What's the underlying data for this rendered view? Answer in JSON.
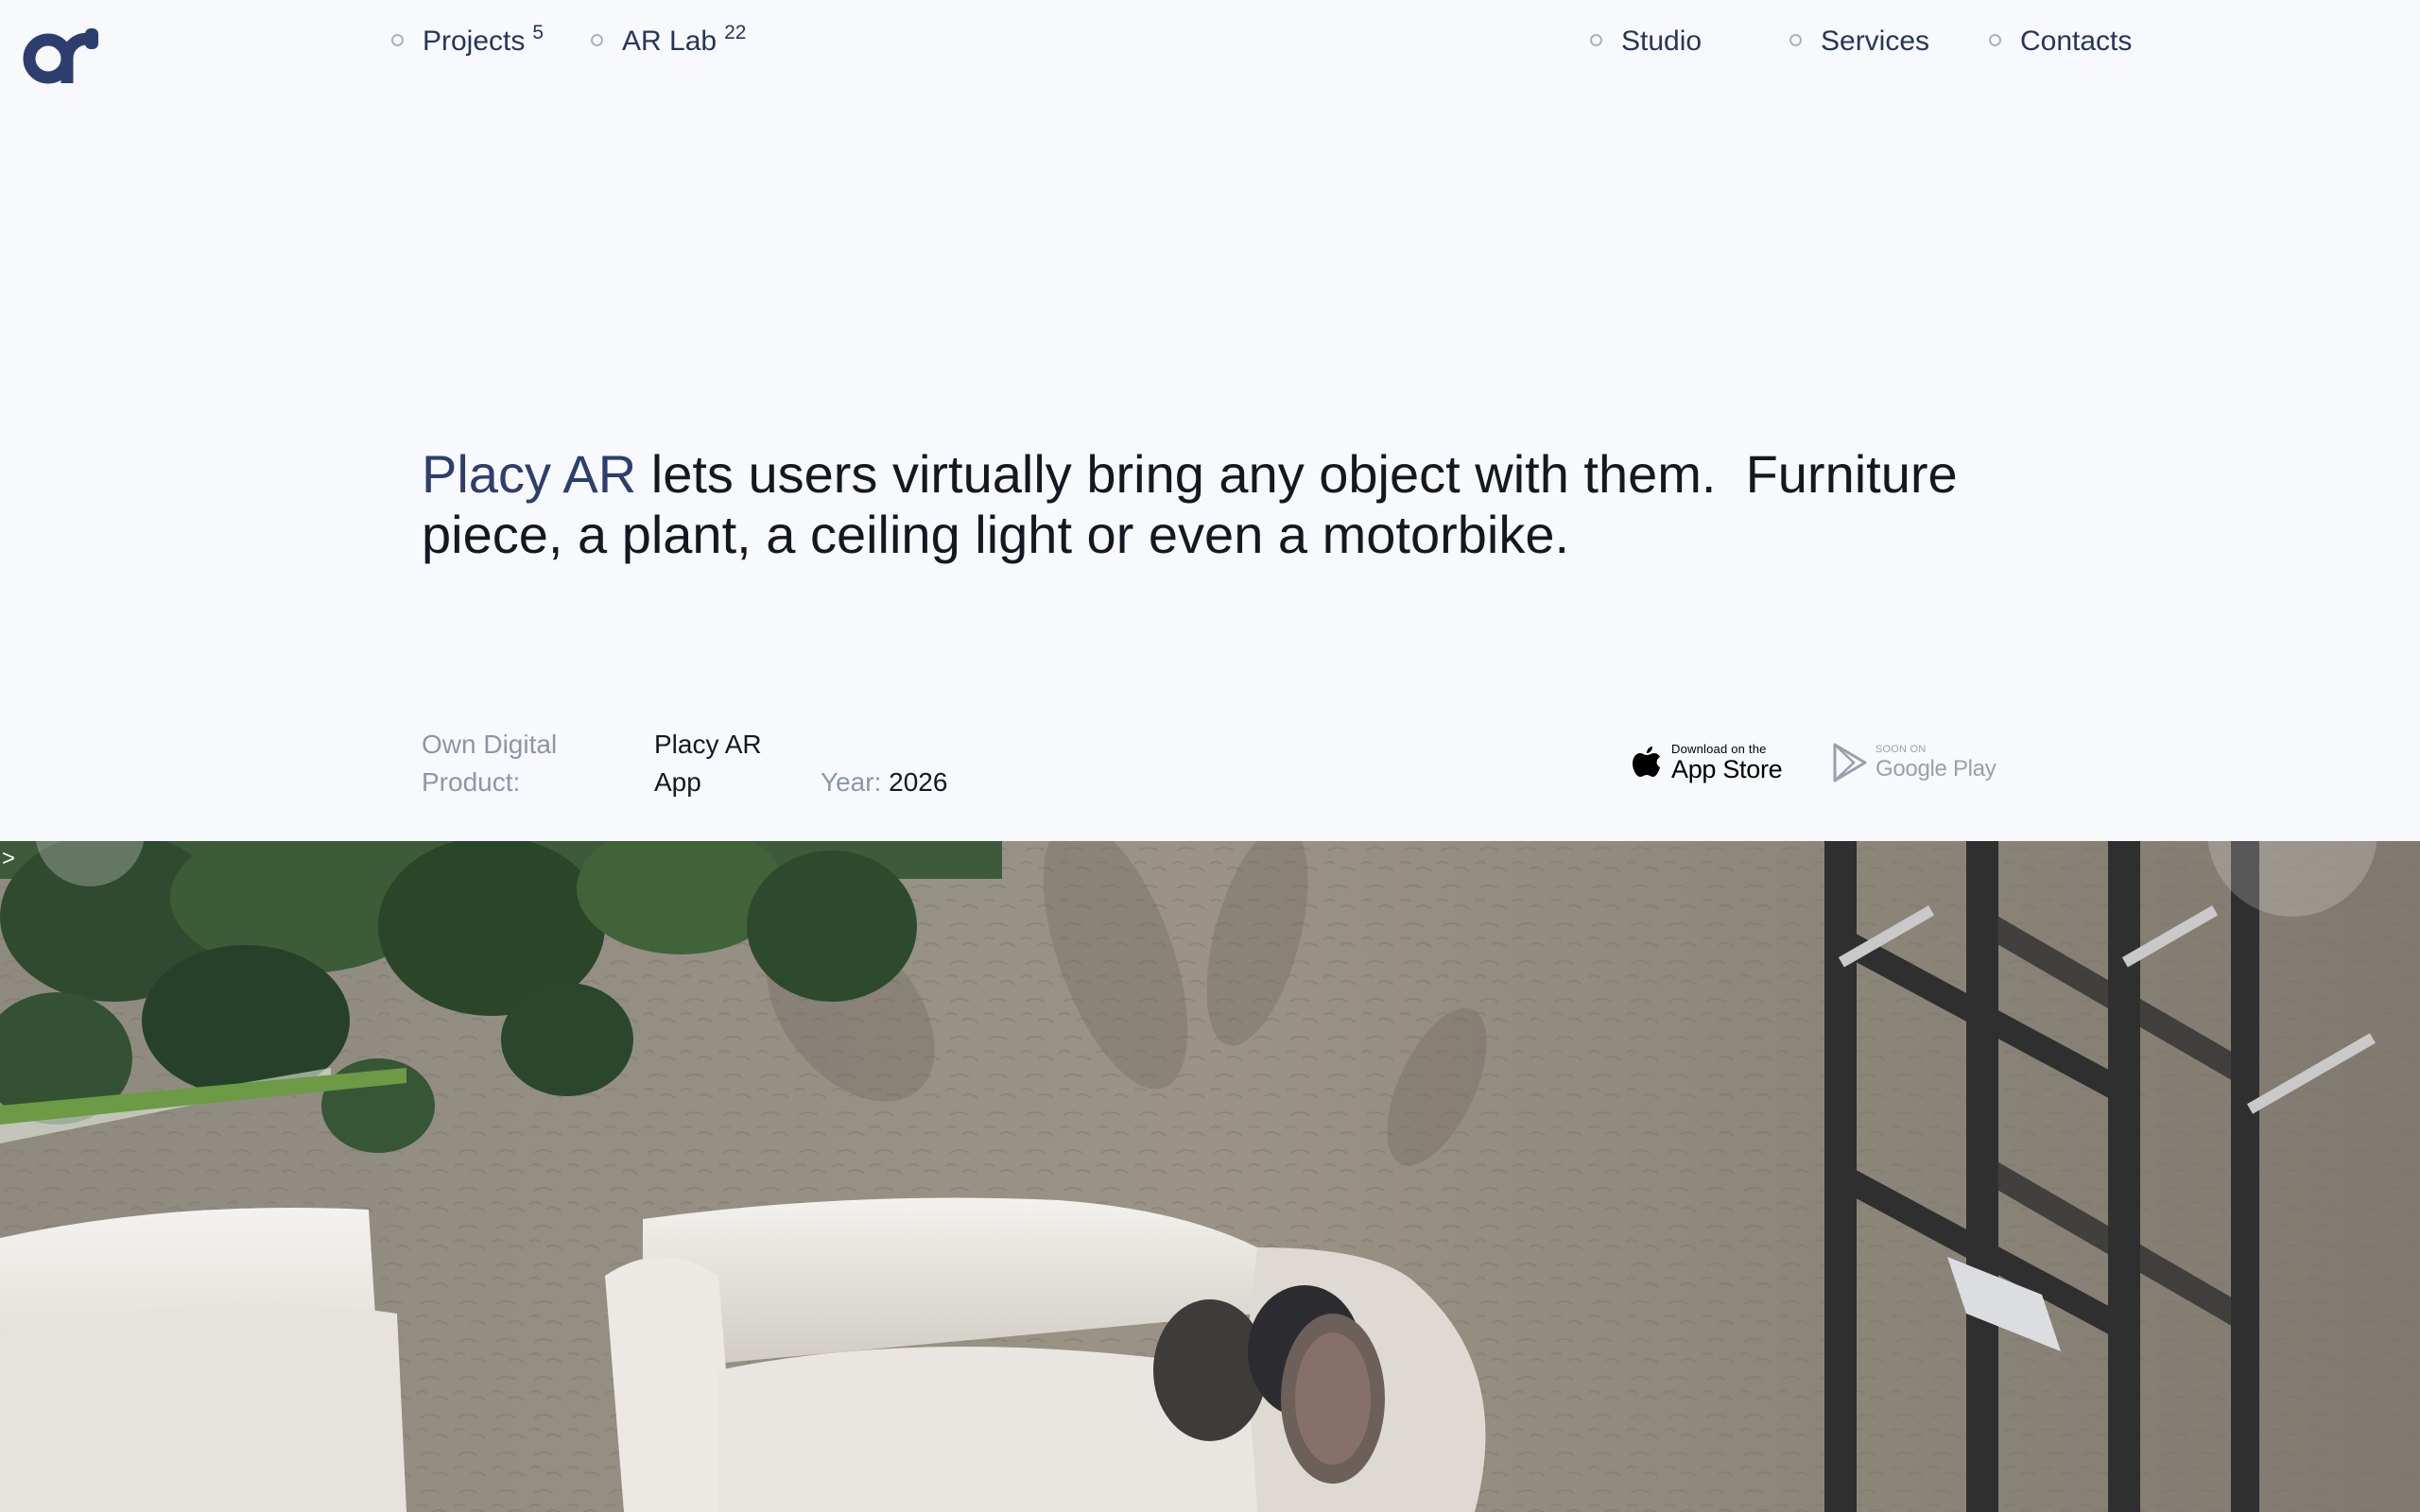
{
  "nav": {
    "left": [
      {
        "label": "Projects",
        "count": "5"
      },
      {
        "label": "AR Lab",
        "count": "22"
      }
    ],
    "right": [
      {
        "label": "Studio"
      },
      {
        "label": "Services"
      },
      {
        "label": "Contacts"
      }
    ]
  },
  "headline": {
    "brand": "Placy AR",
    "line1_rest": " lets users virtually bring any object with them.  Furniture",
    "line2": "piece, a plant, a ceiling light or even a motorbike."
  },
  "meta": {
    "type_label_line1": "Own Digital",
    "type_label_line2": "Product:",
    "type_value_line1": "Placy AR",
    "type_value_line2": "App",
    "year_label": "Year:",
    "year_value": "2026"
  },
  "stores": {
    "appstore_small": "Download on the",
    "appstore_big": "App Store",
    "googleplay_small": "SOON ON",
    "googleplay_big": "Google Play"
  },
  "hero": {
    "corner_glyph": ">"
  },
  "colors": {
    "background": "#f8f9fc",
    "brand": "#2d3e6e",
    "muted": "#8d96a8",
    "text": "#141821"
  },
  "icons": [
    "logo-icon",
    "apple-icon",
    "google-play-icon"
  ]
}
